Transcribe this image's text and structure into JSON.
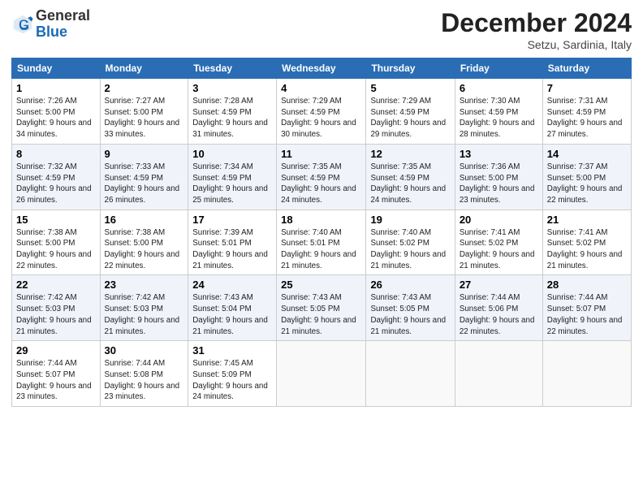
{
  "header": {
    "logo_general": "General",
    "logo_blue": "Blue",
    "month_title": "December 2024",
    "subtitle": "Setzu, Sardinia, Italy"
  },
  "weekdays": [
    "Sunday",
    "Monday",
    "Tuesday",
    "Wednesday",
    "Thursday",
    "Friday",
    "Saturday"
  ],
  "weeks": [
    [
      {
        "day": "1",
        "sunrise": "7:26 AM",
        "sunset": "5:00 PM",
        "daylight": "9 hours and 34 minutes."
      },
      {
        "day": "2",
        "sunrise": "7:27 AM",
        "sunset": "5:00 PM",
        "daylight": "9 hours and 33 minutes."
      },
      {
        "day": "3",
        "sunrise": "7:28 AM",
        "sunset": "4:59 PM",
        "daylight": "9 hours and 31 minutes."
      },
      {
        "day": "4",
        "sunrise": "7:29 AM",
        "sunset": "4:59 PM",
        "daylight": "9 hours and 30 minutes."
      },
      {
        "day": "5",
        "sunrise": "7:29 AM",
        "sunset": "4:59 PM",
        "daylight": "9 hours and 29 minutes."
      },
      {
        "day": "6",
        "sunrise": "7:30 AM",
        "sunset": "4:59 PM",
        "daylight": "9 hours and 28 minutes."
      },
      {
        "day": "7",
        "sunrise": "7:31 AM",
        "sunset": "4:59 PM",
        "daylight": "9 hours and 27 minutes."
      }
    ],
    [
      {
        "day": "8",
        "sunrise": "7:32 AM",
        "sunset": "4:59 PM",
        "daylight": "9 hours and 26 minutes."
      },
      {
        "day": "9",
        "sunrise": "7:33 AM",
        "sunset": "4:59 PM",
        "daylight": "9 hours and 26 minutes."
      },
      {
        "day": "10",
        "sunrise": "7:34 AM",
        "sunset": "4:59 PM",
        "daylight": "9 hours and 25 minutes."
      },
      {
        "day": "11",
        "sunrise": "7:35 AM",
        "sunset": "4:59 PM",
        "daylight": "9 hours and 24 minutes."
      },
      {
        "day": "12",
        "sunrise": "7:35 AM",
        "sunset": "4:59 PM",
        "daylight": "9 hours and 24 minutes."
      },
      {
        "day": "13",
        "sunrise": "7:36 AM",
        "sunset": "5:00 PM",
        "daylight": "9 hours and 23 minutes."
      },
      {
        "day": "14",
        "sunrise": "7:37 AM",
        "sunset": "5:00 PM",
        "daylight": "9 hours and 22 minutes."
      }
    ],
    [
      {
        "day": "15",
        "sunrise": "7:38 AM",
        "sunset": "5:00 PM",
        "daylight": "9 hours and 22 minutes."
      },
      {
        "day": "16",
        "sunrise": "7:38 AM",
        "sunset": "5:00 PM",
        "daylight": "9 hours and 22 minutes."
      },
      {
        "day": "17",
        "sunrise": "7:39 AM",
        "sunset": "5:01 PM",
        "daylight": "9 hours and 21 minutes."
      },
      {
        "day": "18",
        "sunrise": "7:40 AM",
        "sunset": "5:01 PM",
        "daylight": "9 hours and 21 minutes."
      },
      {
        "day": "19",
        "sunrise": "7:40 AM",
        "sunset": "5:02 PM",
        "daylight": "9 hours and 21 minutes."
      },
      {
        "day": "20",
        "sunrise": "7:41 AM",
        "sunset": "5:02 PM",
        "daylight": "9 hours and 21 minutes."
      },
      {
        "day": "21",
        "sunrise": "7:41 AM",
        "sunset": "5:02 PM",
        "daylight": "9 hours and 21 minutes."
      }
    ],
    [
      {
        "day": "22",
        "sunrise": "7:42 AM",
        "sunset": "5:03 PM",
        "daylight": "9 hours and 21 minutes."
      },
      {
        "day": "23",
        "sunrise": "7:42 AM",
        "sunset": "5:03 PM",
        "daylight": "9 hours and 21 minutes."
      },
      {
        "day": "24",
        "sunrise": "7:43 AM",
        "sunset": "5:04 PM",
        "daylight": "9 hours and 21 minutes."
      },
      {
        "day": "25",
        "sunrise": "7:43 AM",
        "sunset": "5:05 PM",
        "daylight": "9 hours and 21 minutes."
      },
      {
        "day": "26",
        "sunrise": "7:43 AM",
        "sunset": "5:05 PM",
        "daylight": "9 hours and 21 minutes."
      },
      {
        "day": "27",
        "sunrise": "7:44 AM",
        "sunset": "5:06 PM",
        "daylight": "9 hours and 22 minutes."
      },
      {
        "day": "28",
        "sunrise": "7:44 AM",
        "sunset": "5:07 PM",
        "daylight": "9 hours and 22 minutes."
      }
    ],
    [
      {
        "day": "29",
        "sunrise": "7:44 AM",
        "sunset": "5:07 PM",
        "daylight": "9 hours and 23 minutes."
      },
      {
        "day": "30",
        "sunrise": "7:44 AM",
        "sunset": "5:08 PM",
        "daylight": "9 hours and 23 minutes."
      },
      {
        "day": "31",
        "sunrise": "7:45 AM",
        "sunset": "5:09 PM",
        "daylight": "9 hours and 24 minutes."
      },
      null,
      null,
      null,
      null
    ]
  ]
}
